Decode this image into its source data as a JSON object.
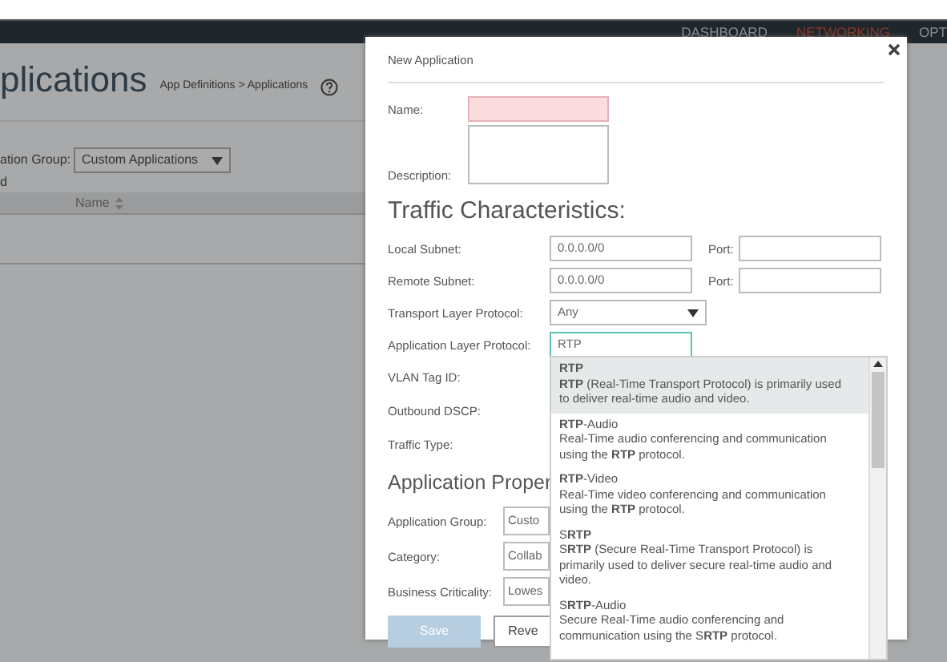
{
  "top_nav": [
    {
      "label": "DASHBOARD",
      "selected": false
    },
    {
      "label": "NETWORKING",
      "selected": true
    },
    {
      "label": "OPT",
      "selected": false
    }
  ],
  "page": {
    "title": "plications",
    "breadcrumb": "App Definitions > Applications",
    "group_label": "ation Group:",
    "group_value": "Custom Applications",
    "line_text": "d",
    "table_columns": [
      "Name"
    ]
  },
  "dialog": {
    "title": "New Application",
    "name": {
      "label": "Name:",
      "invalid": true
    },
    "description": {
      "label": "Description:"
    },
    "traffic_heading": "Traffic Characteristics:",
    "traffic_fields": [
      {
        "kind": "subnet",
        "label": "Local Subnet:",
        "value": "0.0.0.0/0",
        "port_label": "Port:"
      },
      {
        "kind": "subnet",
        "label": "Remote Subnet:",
        "value": "0.0.0.0/0",
        "port_label": "Port:"
      },
      {
        "kind": "select",
        "label": "Transport Layer Protocol:",
        "value": "Any"
      },
      {
        "kind": "text",
        "label": "Application Layer Protocol:",
        "value": "RTP",
        "focused": true
      },
      {
        "kind": "covered",
        "label": "VLAN Tag ID:"
      },
      {
        "kind": "covered",
        "label": "Outbound DSCP:"
      },
      {
        "kind": "covered",
        "label": "Traffic Type:"
      }
    ],
    "properties_heading": "Application Proper",
    "property_fields": [
      {
        "label": "Application Group:",
        "value": "Custo"
      },
      {
        "label": "Category:",
        "value": "Collab"
      },
      {
        "label": "Business Criticality:",
        "value": "Lowes"
      }
    ],
    "buttons": [
      {
        "label": "Save",
        "kind": "primary",
        "disabled": true
      },
      {
        "label": "Reve",
        "kind": "secondary",
        "disabled": false
      }
    ],
    "suggestions": [
      {
        "title": "**RTP**",
        "description": "**RTP** (Real-Time Transport Protocol) is primarily used to deliver real-time audio and video.",
        "highlighted": true
      },
      {
        "title": "**RTP**-Audio",
        "description": "Real-Time audio conferencing and communication using the **RTP** protocol.",
        "highlighted": false
      },
      {
        "title": "**RTP**-Video",
        "description": "Real-Time video conferencing and communication using the **RTP** protocol.",
        "highlighted": false
      },
      {
        "title": "S**RTP**",
        "description": "S**RTP** (Secure Real-Time Transport Protocol) is primarily used to deliver secure real-time audio and video.",
        "highlighted": false
      },
      {
        "title": "S**RTP**-Audio",
        "description": "Secure Real-Time audio conferencing and communication using the S**RTP** protocol.",
        "highlighted": false
      }
    ]
  }
}
